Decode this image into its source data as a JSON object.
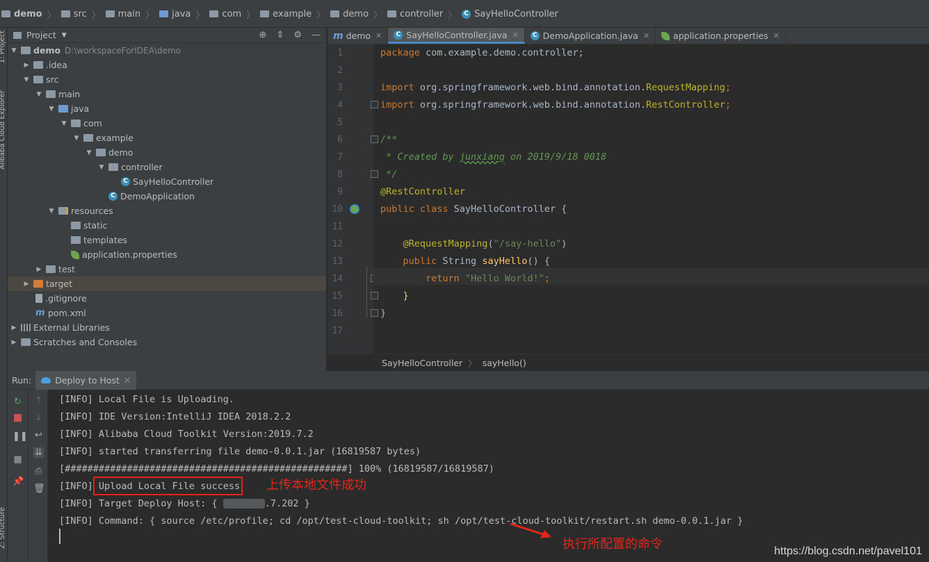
{
  "breadcrumb": [
    "demo",
    "src",
    "main",
    "java",
    "com",
    "example",
    "demo",
    "controller",
    "SayHelloController"
  ],
  "side_tabs": {
    "project": "1: Project",
    "cloud": "Alibaba Cloud Explorer",
    "structure": "Z: Structure"
  },
  "project": {
    "title": "Project",
    "root": {
      "name": "demo",
      "path": "D:\\workspaceForIDEA\\demo"
    },
    "items": [
      "demo",
      ".idea",
      "src",
      "main",
      "java",
      "com",
      "example",
      "demo",
      "controller",
      "SayHelloController",
      "DemoApplication",
      "resources",
      "static",
      "templates",
      "application.properties",
      "test",
      "target",
      ".gitignore",
      "pom.xml",
      "External Libraries",
      "Scratches and Consoles"
    ]
  },
  "editor": {
    "tabs": [
      "demo",
      "SayHelloController.java",
      "DemoApplication.java",
      "application.properties"
    ],
    "line_numbers": [
      "1",
      "2",
      "3",
      "4",
      "5",
      "6",
      "7",
      "8",
      "9",
      "10",
      "11",
      "12",
      "13",
      "14",
      "15",
      "16",
      "17"
    ],
    "code": {
      "l1a": "package",
      "l1b": " com.example.demo.controller;",
      "l3a": "import",
      "l3b": " org.springframework.web.bind.annotation.",
      "l3c": "RequestMapping",
      "l3d": ";",
      "l4a": "import",
      "l4b": " org.springframework.web.bind.annotation.",
      "l4c": "RestController",
      "l4d": ";",
      "l6": "/**",
      "l7a": " * Created by ",
      "l7b": "junxiang",
      "l7c": " on 2019/9/18 0018",
      "l8": " */",
      "l9": "@RestController",
      "l10a": "public class",
      "l10b": " SayHelloController {",
      "l12a": "    @RequestMapping",
      "l12b": "(",
      "l12c": "\"/say-hello\"",
      "l12d": ")",
      "l13a": "    public",
      "l13b": " String ",
      "l13c": "sayHello",
      "l13d": "() {",
      "l14a": "        return",
      "l14b": " \"Hello World!\"",
      "l14c": ";",
      "l15": "    }",
      "l16": "}"
    },
    "crumb_class": "SayHelloController",
    "crumb_method": "sayHello()"
  },
  "run": {
    "label": "Run:",
    "tab": "Deploy to Host",
    "lines": [
      "[INFO] Local File is Uploading.",
      "[INFO] IDE Version:IntelliJ IDEA 2018.2.2",
      "[INFO] Alibaba Cloud Toolkit Version:2019.7.2",
      "[INFO] started transferring file demo-0.0.1.jar (16819587 bytes)",
      "[##################################################] 100% (16819587/16819587)",
      "[INFO] Upload Local File success",
      "[INFO] Target Deploy Host: {",
      "[INFO] Command: { source /etc/profile; cd /opt/test-cloud-toolkit; sh /opt/test-cloud-toolkit/restart.sh demo-0.0.1.jar }"
    ],
    "host_tail": ".7.202 }",
    "annot_upload": "上传本地文件成功",
    "annot_command": "执行所配置的命令",
    "watermark": "https://blog.csdn.net/pavel101"
  },
  "colors": {
    "highlight": "#e62117",
    "keyword": "#cc7832",
    "string": "#6a8759",
    "annotation": "#bbb529"
  }
}
